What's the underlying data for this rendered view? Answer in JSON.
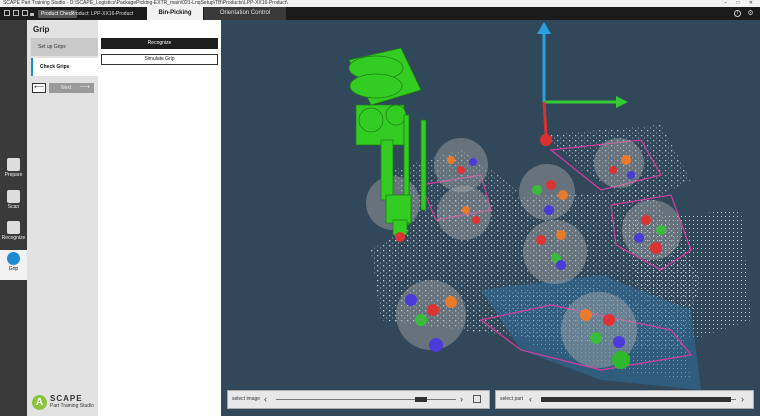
{
  "window": {
    "title": "SCAPE Part Training Studio - D:\\SCAPE_Logistics\\PackagePicking-EXTR_main\\021-LnqSetup\\TB\\Products\\LPP-XX16-Product\\",
    "controls": "–  □  ✕"
  },
  "toolbar": {
    "product_check_label": "Product Check",
    "product_label": "Product: LPP-XX16-Product",
    "tabs": [
      {
        "label": "Bin-Picking",
        "active": true
      },
      {
        "label": "Orientation Control",
        "active": false
      }
    ],
    "info_icon": "i",
    "settings_icon": "⚙"
  },
  "nav": {
    "items": [
      {
        "label": "Prepare",
        "icon": "prepare-icon"
      },
      {
        "label": "Scan",
        "icon": "scan-icon"
      },
      {
        "label": "Recognize",
        "icon": "recognize-icon"
      },
      {
        "label": "Grip",
        "icon": "grip-icon",
        "active": true
      }
    ]
  },
  "panel": {
    "title": "Grip",
    "steps": [
      {
        "label": "Set up Grips",
        "active": false
      },
      {
        "label": "Check Grips",
        "active": true
      }
    ],
    "back_symbol": "⟵",
    "next_label": "Next",
    "next_symbol": "⟶",
    "recognize_button": "Recognize",
    "simulate_button": "Simulate Grip"
  },
  "logo": {
    "letter": "A",
    "name": "SCAPE",
    "tagline": "Part Training Studio"
  },
  "image_slider": {
    "label": "select image",
    "position": 0.83,
    "left_chevron": "‹",
    "right_chevron": "›"
  },
  "part_slider": {
    "label": "select part",
    "position": 0.05,
    "left_chevron": "‹",
    "right_chevron": "›"
  },
  "colors": {
    "accent": "#1f8ad1",
    "viewport_bg": "#31485a",
    "gripper": "#33cc22",
    "axis_x": "#33cc33",
    "axis_y": "#2aa0e0",
    "axis_z": "#d93030",
    "contour": "#d63aa0"
  }
}
